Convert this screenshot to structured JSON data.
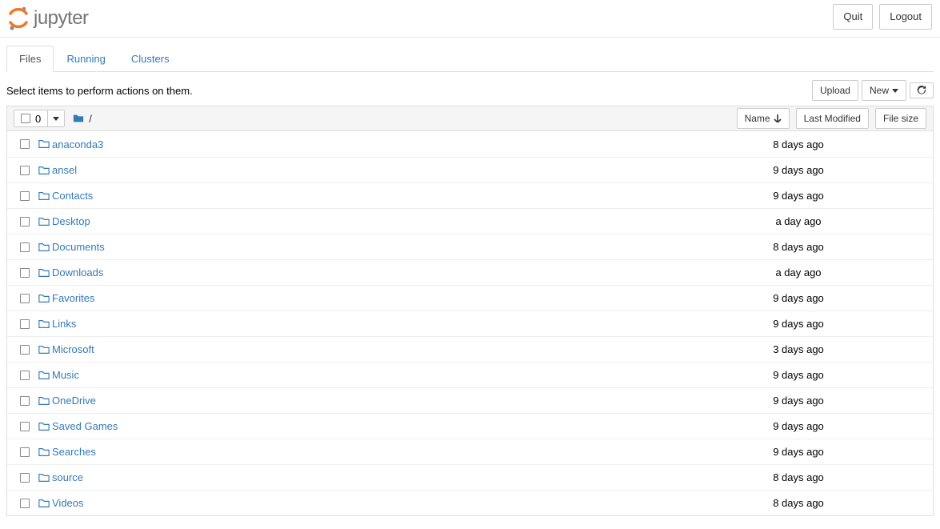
{
  "brand": "jupyter",
  "header": {
    "quit": "Quit",
    "logout": "Logout"
  },
  "tabs": [
    {
      "label": "Files",
      "active": true
    },
    {
      "label": "Running",
      "active": false
    },
    {
      "label": "Clusters",
      "active": false
    }
  ],
  "hint": "Select items to perform actions on them.",
  "toolbar": {
    "upload": "Upload",
    "new": "New"
  },
  "list_header": {
    "selected_count": "0",
    "path": "/",
    "name_col": "Name",
    "modified_col": "Last Modified",
    "size_col": "File size"
  },
  "items": [
    {
      "name": "anaconda3",
      "modified": "8 days ago",
      "size": ""
    },
    {
      "name": "ansel",
      "modified": "9 days ago",
      "size": ""
    },
    {
      "name": "Contacts",
      "modified": "9 days ago",
      "size": ""
    },
    {
      "name": "Desktop",
      "modified": "a day ago",
      "size": ""
    },
    {
      "name": "Documents",
      "modified": "8 days ago",
      "size": ""
    },
    {
      "name": "Downloads",
      "modified": "a day ago",
      "size": ""
    },
    {
      "name": "Favorites",
      "modified": "9 days ago",
      "size": ""
    },
    {
      "name": "Links",
      "modified": "9 days ago",
      "size": ""
    },
    {
      "name": "Microsoft",
      "modified": "3 days ago",
      "size": ""
    },
    {
      "name": "Music",
      "modified": "9 days ago",
      "size": ""
    },
    {
      "name": "OneDrive",
      "modified": "9 days ago",
      "size": ""
    },
    {
      "name": "Saved Games",
      "modified": "9 days ago",
      "size": ""
    },
    {
      "name": "Searches",
      "modified": "9 days ago",
      "size": ""
    },
    {
      "name": "source",
      "modified": "8 days ago",
      "size": ""
    },
    {
      "name": "Videos",
      "modified": "8 days ago",
      "size": ""
    }
  ]
}
